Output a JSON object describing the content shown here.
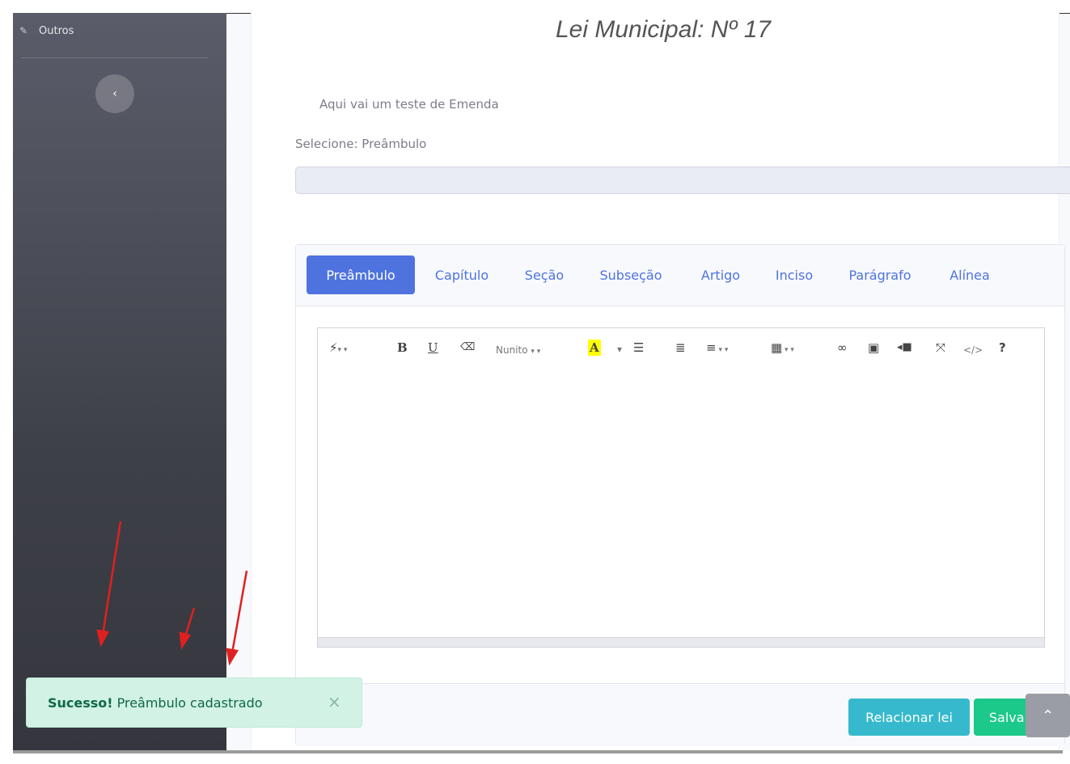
{
  "sidebar": {
    "item_label": "Outros",
    "item_icon": "edit-icon",
    "toggle_icon": "chevron-left-icon"
  },
  "header": {
    "title": "Lei Municipal: Nº 17"
  },
  "content": {
    "subtitle": "Aqui vai um teste de Emenda",
    "select_label": "Selecione: Preâmbulo"
  },
  "tabs": [
    {
      "label": "Preâmbulo",
      "active": true
    },
    {
      "label": "Capítulo",
      "active": false
    },
    {
      "label": "Seção",
      "active": false
    },
    {
      "label": "Subseção",
      "active": false
    },
    {
      "label": "Artigo",
      "active": false
    },
    {
      "label": "Inciso",
      "active": false
    },
    {
      "label": "Parágrafo",
      "active": false
    },
    {
      "label": "Alínea",
      "active": false
    }
  ],
  "toolbar": {
    "bold": "B",
    "underline": "U",
    "font_name": "Nunito",
    "font_color": "A",
    "code": "</>",
    "help": "?"
  },
  "footer": {
    "relacionar_label": "Relacionar lei",
    "salvar_label": "Salvar"
  },
  "toast": {
    "strong": "Sucesso!",
    "message": "Preâmbulo cadastrado",
    "close": "×"
  },
  "colors": {
    "primary": "#4e73df",
    "info": "#36b9cc",
    "success": "#1cc88a",
    "toast_bg": "#d1f2e4",
    "annotation_red": "#e02020"
  }
}
